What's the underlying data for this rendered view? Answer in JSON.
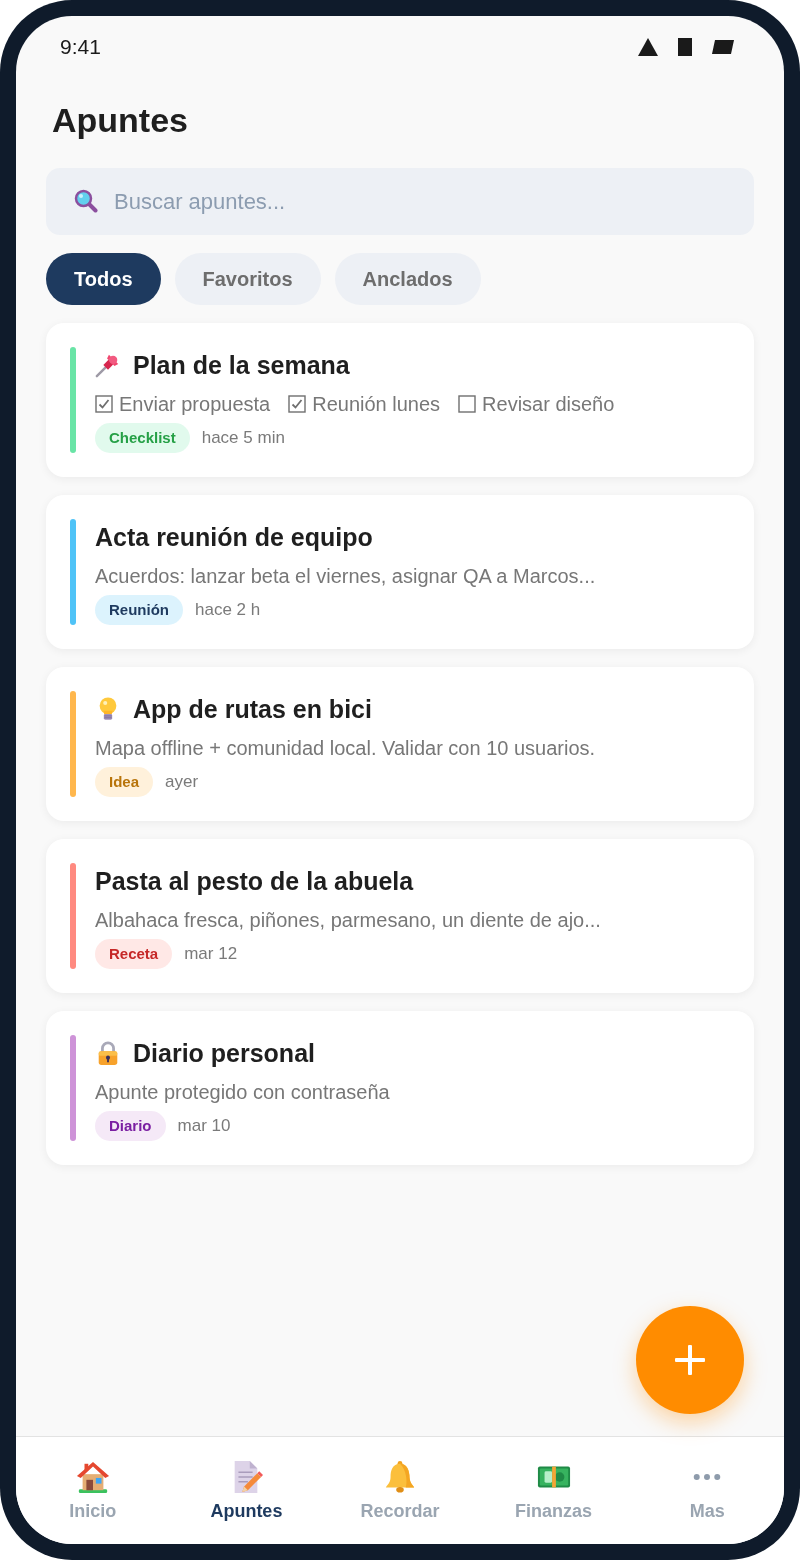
{
  "status_bar": {
    "time": "9:41"
  },
  "header": {
    "title": "Apuntes"
  },
  "search": {
    "placeholder": "Buscar apuntes..."
  },
  "filters": [
    {
      "label": "Todos",
      "selected": true
    },
    {
      "label": "Favoritos",
      "selected": false
    },
    {
      "label": "Anclados",
      "selected": false
    }
  ],
  "notes": [
    {
      "title": "Plan de la semana",
      "kind": "checklist",
      "pinned": true,
      "locked": false,
      "color": "#69e4a6",
      "items": [
        {
          "label": "Enviar propuesta",
          "checked": true
        },
        {
          "label": "Reunión lunes",
          "checked": true
        },
        {
          "label": "Revisar diseño",
          "checked": false
        }
      ],
      "tag": {
        "label": "Checklist",
        "color": "#25a046"
      },
      "time": "hace 5 min"
    },
    {
      "title": "Acta reunión de equipo",
      "kind": "text",
      "pinned": false,
      "locked": false,
      "color": "#4fc3f7",
      "preview": "Acuerdos: lanzar beta el viernes, asignar QA a Marcos...",
      "tag": {
        "label": "Reunión",
        "color": "#1e3a5f"
      },
      "time": "hace 2 h"
    },
    {
      "title": "App de rutas en bici",
      "kind": "idea",
      "pinned": false,
      "locked": false,
      "color": "#ffb74d",
      "preview": "Mapa offline + comunidad local. Validar con 10 usuarios.",
      "tag": {
        "label": "Idea",
        "color": "#b8740a"
      },
      "time": "ayer"
    },
    {
      "title": "Pasta al pesto de la abuela",
      "kind": "text",
      "pinned": false,
      "locked": false,
      "color": "#ff8a80",
      "preview": "Albahaca fresca, piñones, parmesano, un diente de ajo...",
      "tag": {
        "label": "Receta",
        "color": "#c62828"
      },
      "time": "mar 12"
    },
    {
      "title": "Diario personal",
      "kind": "text",
      "pinned": false,
      "locked": true,
      "color": "#ce93d8",
      "preview": "Apunte protegido con contraseña",
      "tag": {
        "label": "Diario",
        "color": "#7b1fa2"
      },
      "time": "mar 10"
    }
  ],
  "nav": [
    {
      "label": "Inicio",
      "selected": false
    },
    {
      "label": "Apuntes",
      "selected": true
    },
    {
      "label": "Recordar",
      "selected": false
    },
    {
      "label": "Finanzas",
      "selected": false
    },
    {
      "label": "Mas",
      "selected": false
    }
  ]
}
